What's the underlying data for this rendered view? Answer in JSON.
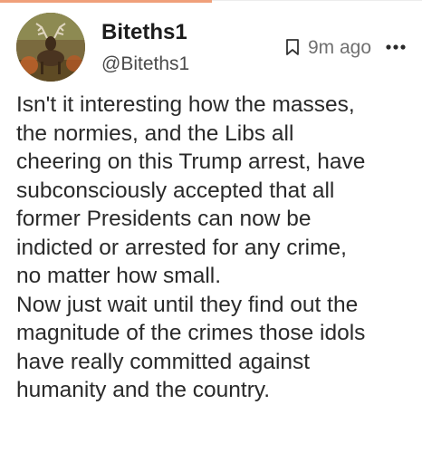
{
  "post": {
    "display_name": "Biteths1",
    "handle": "@Biteths1",
    "timestamp": "9m ago",
    "body_lines": [
      "Isn't it interesting how the masses,",
      "the normies, and the Libs all",
      "cheering on this Trump arrest, have",
      "subconsciously accepted that all",
      "former Presidents can now be",
      "indicted or arrested for any crime,",
      "no matter how small.",
      "Now just wait until they find out the",
      "magnitude of the crimes those idols",
      "have really committed against",
      "humanity and the country."
    ]
  },
  "icons": {
    "bookmark": "bookmark-icon",
    "more": "more-options-icon",
    "avatar": "avatar-image"
  },
  "colors": {
    "accent": "#f0a07a",
    "text": "#2a2a2a",
    "muted": "#707070"
  }
}
